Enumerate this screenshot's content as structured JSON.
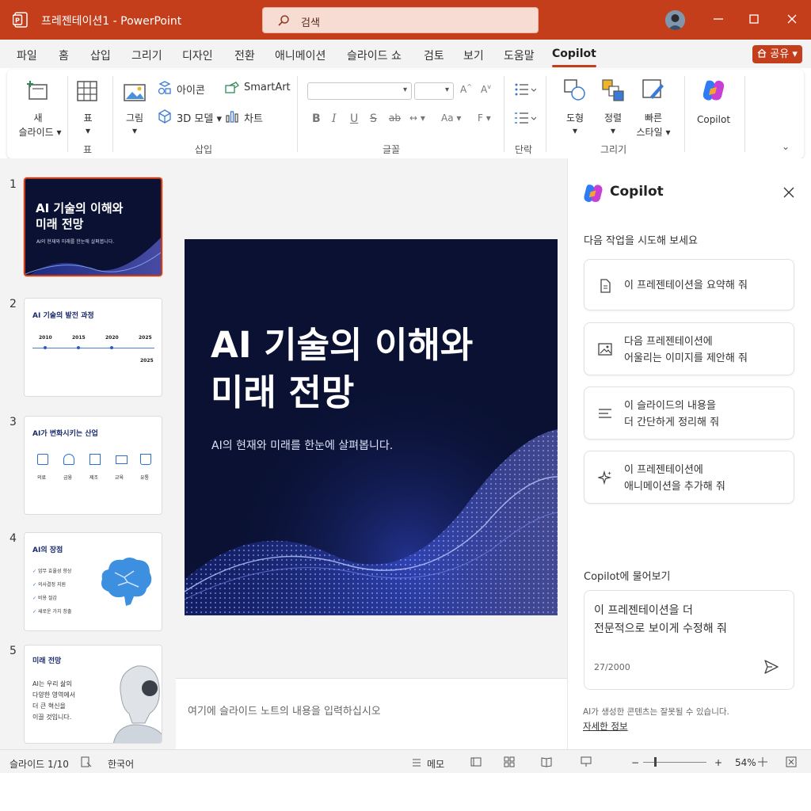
{
  "titlebar": {
    "doc_title": "프레젠테이션1  -  PowerPoint",
    "search_placeholder": "검색"
  },
  "menu": {
    "items": [
      "파일",
      "홈",
      "삽입",
      "그리기",
      "디자인",
      "전환",
      "애니메이션",
      "슬라이드 쇼",
      "검토",
      "보기",
      "도움말",
      "Copilot"
    ],
    "active": "Copilot",
    "share_label": "공유"
  },
  "ribbon": {
    "new_slide": {
      "line1": "새",
      "line2": "슬라이드"
    },
    "table_label": "표",
    "groups": {
      "table": "표",
      "insert": "삽입",
      "font": "글꼴",
      "paragraph": "단락",
      "draw": "그리기"
    },
    "insert": {
      "picture": "그림",
      "icons": "아이콘",
      "model3d": "3D 모델",
      "smartart": "SmartArt",
      "chart": "차트"
    },
    "font_tools": [
      "B",
      "I",
      "U",
      "S",
      "ab"
    ],
    "draw": {
      "shapes": "도형",
      "arrange": "정렬",
      "quick_styles_1": "빠른",
      "quick_styles_2": "스타일"
    },
    "copilot_label": "Copilot"
  },
  "thumbnails": [
    {
      "num": "1",
      "title_1": "AI 기술의 이해와",
      "title_2": "미래 전망",
      "subtitle": "AI의 현재와 미래를 한눈에 살펴봅니다."
    },
    {
      "num": "2",
      "title": "AI 기술의 발전 과정",
      "years": [
        "2010",
        "2015",
        "2020",
        "2025"
      ],
      "year_end": "2025"
    },
    {
      "num": "3",
      "title": "AI가 변화시키는 산업",
      "industries": [
        "의료",
        "금융",
        "제조",
        "교육",
        "유통"
      ]
    },
    {
      "num": "4",
      "title": "AI의 장점",
      "points": [
        "업무 효율성 향상",
        "의사결정 지원",
        "비용 절감",
        "새로운 가치 창출"
      ]
    },
    {
      "num": "5",
      "title": "미래 전망",
      "lines": [
        "AI는 우리 삶의",
        "다양한 영역에서",
        "더 큰 혁신을",
        "이끌 것입니다."
      ]
    }
  ],
  "slide": {
    "title_line1": "AI 기술의 이해와",
    "title_line2": "미래 전망",
    "subtitle": "AI의 현재와 미래를 한눈에 살펴봅니다."
  },
  "notes_placeholder": "여기에 슬라이드 노트의 내용을 입력하십시오",
  "copilot": {
    "title": "Copilot",
    "try_heading": "다음 작업을 시도해 보세요",
    "suggestions": [
      {
        "icon": "document-icon",
        "text": "이 프레젠테이션을 요약해 줘"
      },
      {
        "icon": "image-icon",
        "text": "다음 프레젠테이션에\n어울리는 이미지를 제안해 줘"
      },
      {
        "icon": "list-icon",
        "text": "이 슬라이드의 내용을\n더 간단하게 정리해 줘"
      },
      {
        "icon": "sparkle-icon",
        "text": "이 프레젠테이션에\n애니메이션을 추가해 줘"
      }
    ],
    "ask_heading": "Copilot에 물어보기",
    "prompt_text": "이 프레젠테이션을 더\n전문적으로 보이게 수정해 줘",
    "char_count": "27/2000",
    "disclaimer": "AI가 생성한 콘텐츠는 잘못될 수 있습니다.",
    "more_info": "자세한 정보"
  },
  "status": {
    "slide_counter": "슬라이드 1/10",
    "language": "한국어",
    "notes_label": "메모",
    "zoom": "54%"
  },
  "colors": {
    "accent": "#c43e1c",
    "slide_bg": "#0a1133"
  }
}
